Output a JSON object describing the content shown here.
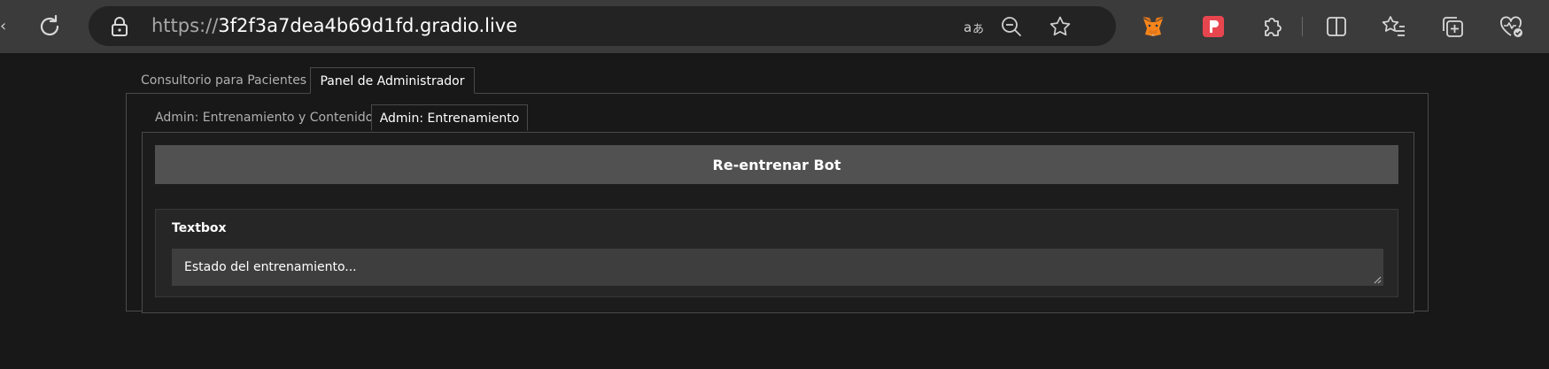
{
  "browser": {
    "url_scheme": "https://",
    "url_host": "3f2f3a7dea4b69d1fd.gradio.live",
    "icons": [
      "back-arrow-icon",
      "reload-icon",
      "lock-icon",
      "read-aloud-icon",
      "zoom-out-icon",
      "favorite-star-icon",
      "metamask-fox-icon",
      "extension-p-icon",
      "extensions-puzzle-icon",
      "split-screen-icon",
      "favorites-list-icon",
      "collections-icon",
      "browser-health-icon"
    ]
  },
  "outer_tabs": [
    {
      "label": "Consultorio para Pacientes",
      "active": false
    },
    {
      "label": "Panel de Administrador",
      "active": true
    }
  ],
  "inner_tabs": [
    {
      "label": "Admin: Entrenamiento y Contenido",
      "active": false
    },
    {
      "label": "Admin: Entrenamiento",
      "active": true
    }
  ],
  "retrain_button": {
    "label": "Re-entrenar Bot"
  },
  "textbox": {
    "label": "Textbox",
    "value": "Estado del entrenamiento..."
  },
  "colors": {
    "page_bg": "#181818",
    "chrome_bg": "#3b3b3b",
    "button_bg": "#515151",
    "textarea_bg": "#3e3e3e"
  }
}
